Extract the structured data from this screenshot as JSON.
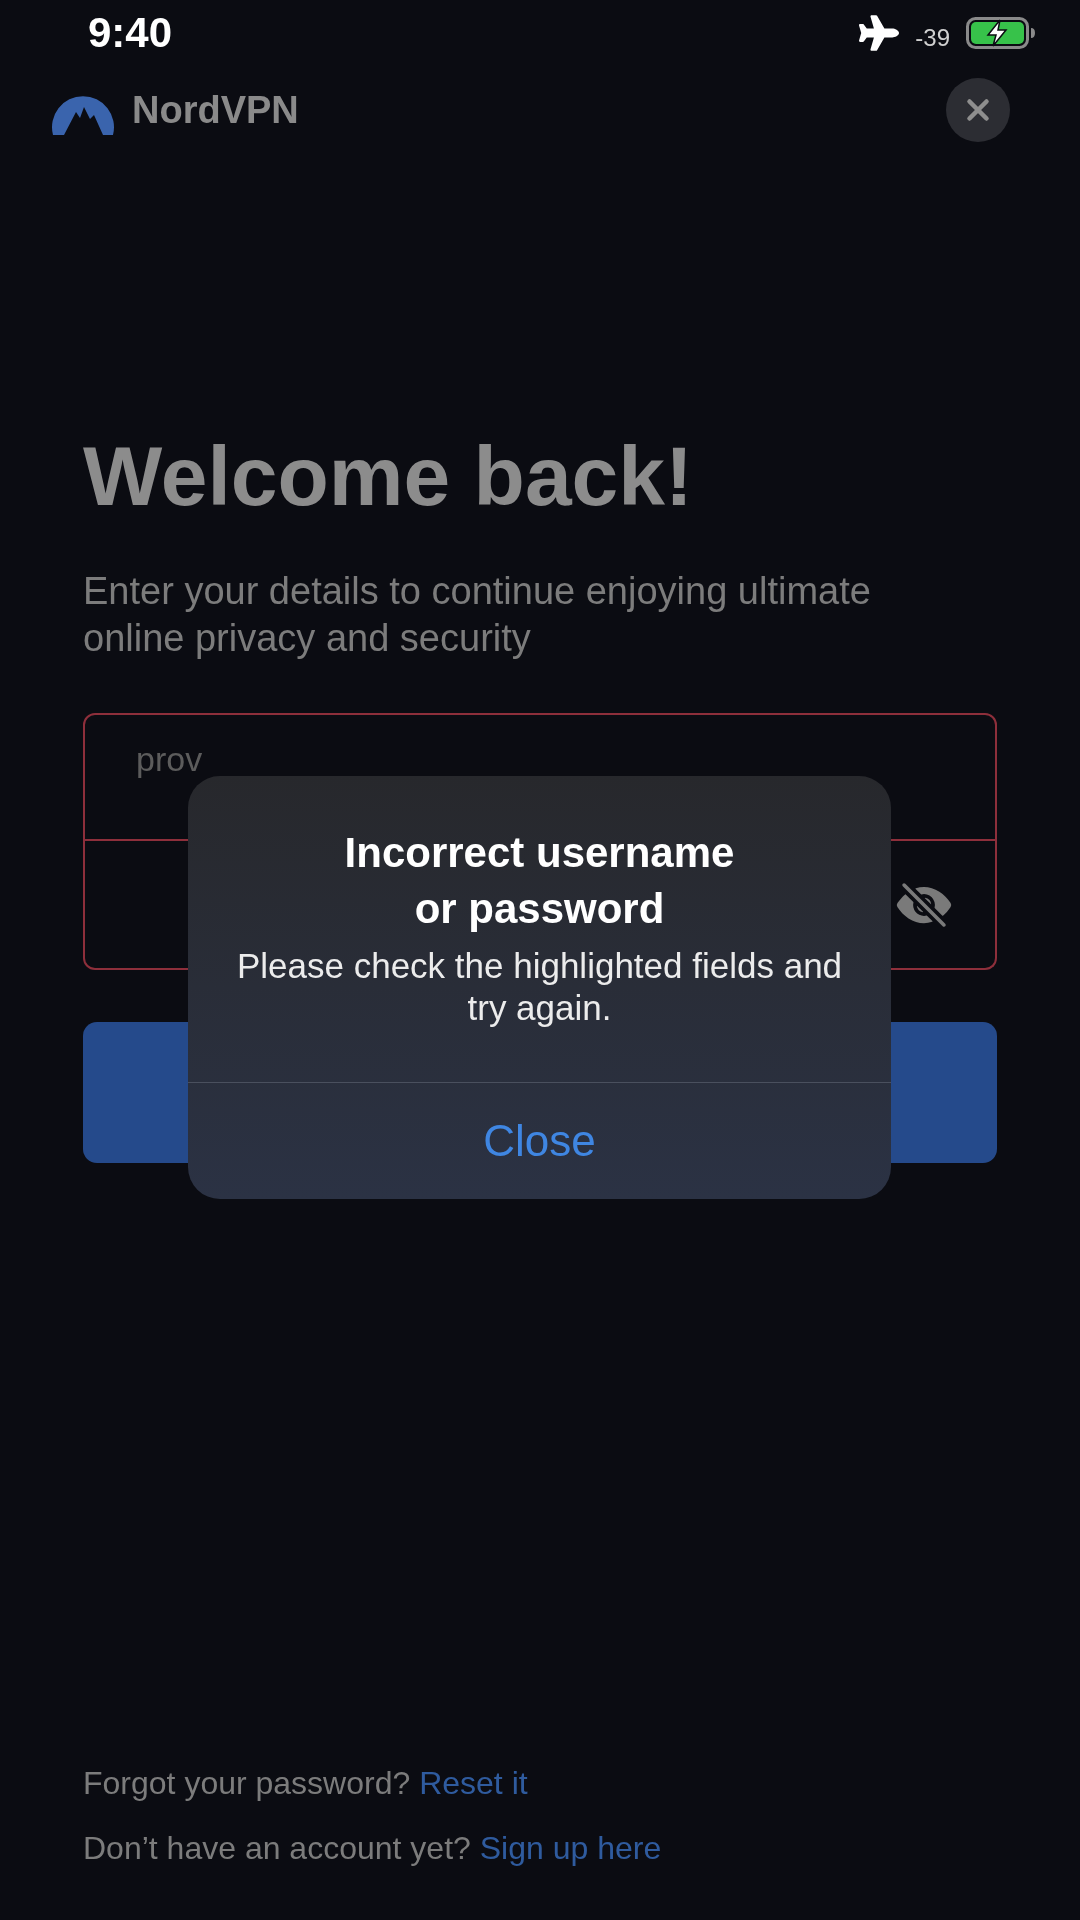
{
  "status_bar": {
    "time": "9:40",
    "signal_reading": "-39"
  },
  "header": {
    "brand": "NordVPN"
  },
  "heading": "Welcome back!",
  "subtitle": "Enter your details to continue enjoying ultimate online privacy and security",
  "fields": [
    {
      "kind": "email",
      "value": "prov",
      "error": true
    },
    {
      "kind": "password",
      "error": true,
      "password_visible": false
    }
  ],
  "alert": {
    "title": "Incorrect username or password",
    "message": "Please check the highlighted fields and try again.",
    "button": "Close"
  },
  "footer": [
    {
      "text": "Forgot your password?",
      "link": "Reset it"
    },
    {
      "text": "Don’t have an account yet?",
      "link": "Sign up here"
    }
  ]
}
